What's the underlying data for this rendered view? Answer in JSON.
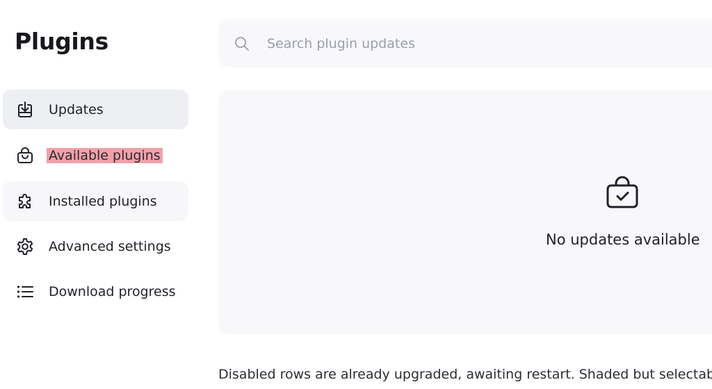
{
  "page": {
    "title": "Plugins"
  },
  "sidebar": {
    "items": [
      {
        "label": "Updates",
        "icon": "download-tray-icon",
        "state": "selected"
      },
      {
        "label": "Available plugins",
        "icon": "shopping-bag-icon",
        "state": "highlighted"
      },
      {
        "label": "Installed plugins",
        "icon": "puzzle-piece-icon",
        "state": "hover"
      },
      {
        "label": "Advanced settings",
        "icon": "gear-icon",
        "state": "normal"
      },
      {
        "label": "Download progress",
        "icon": "list-icon",
        "state": "normal"
      }
    ]
  },
  "search": {
    "placeholder": "Search plugin updates",
    "value": "",
    "icon": "search-icon"
  },
  "main": {
    "empty_state": {
      "icon": "bag-check-icon",
      "text": "No updates available"
    },
    "footer_note": "Disabled rows are already upgraded, awaiting restart. Shaded but selectable ro"
  },
  "colors": {
    "selected_bg": "#eeeff3",
    "hover_bg": "#f7f7fa",
    "highlight_bg": "#f2a0a9",
    "panel_bg": "#f8f8fb",
    "placeholder": "#9b9faa",
    "text": "#1f2128"
  }
}
